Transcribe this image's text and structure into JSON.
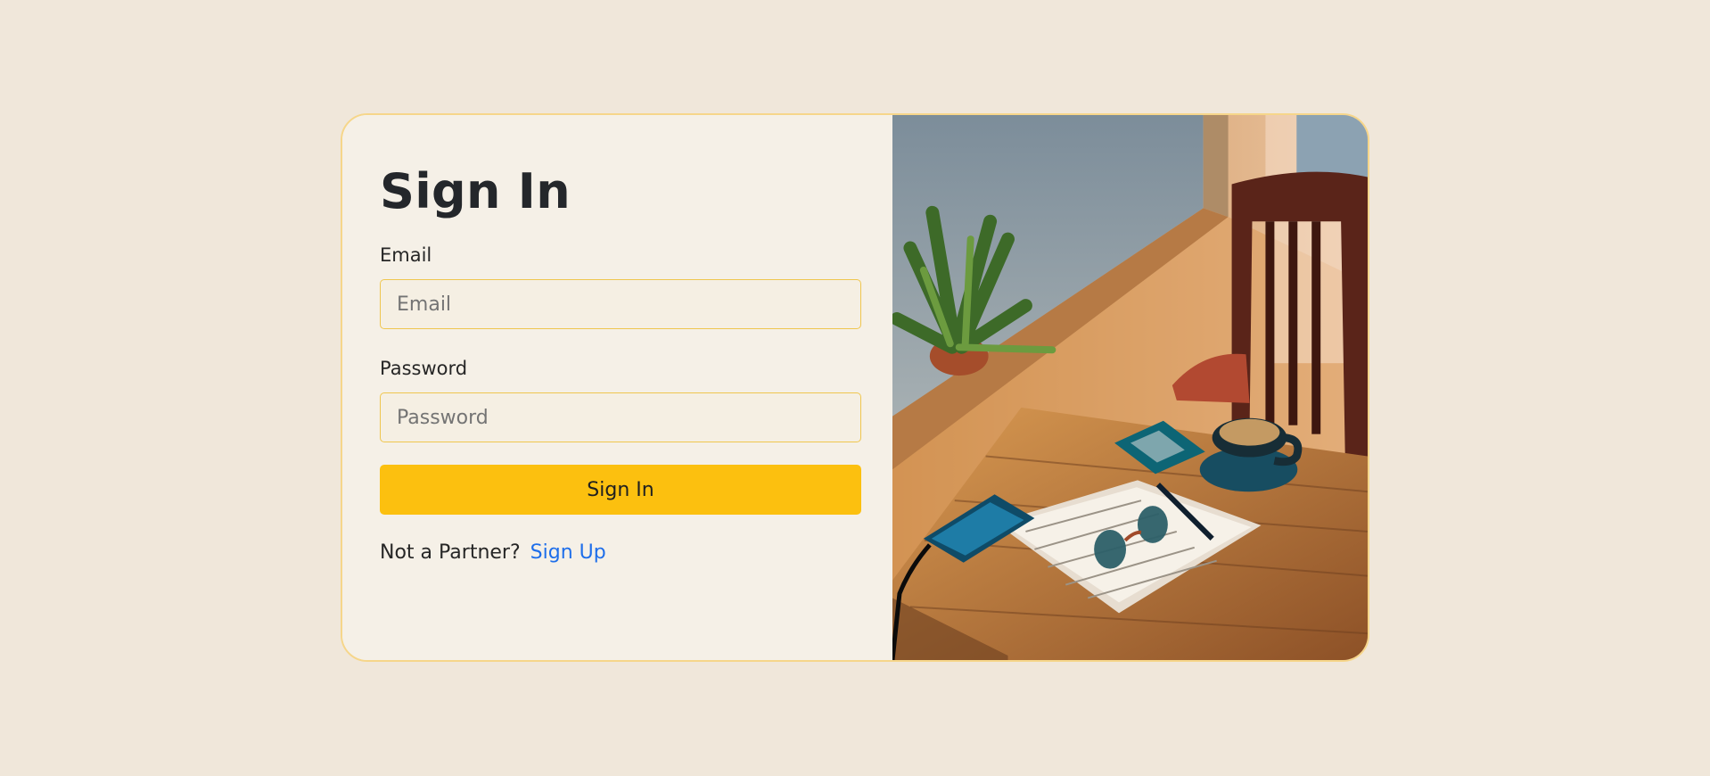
{
  "signin": {
    "title": "Sign In",
    "email_label": "Email",
    "email_placeholder": "Email",
    "email_value": "",
    "password_label": "Password",
    "password_placeholder": "Password",
    "password_value": "",
    "submit_label": "Sign In",
    "signup_prompt": "Not a Partner?",
    "signup_link": "Sign Up"
  },
  "colors": {
    "page_background": "#f0e7da",
    "accent": "#fcc00f",
    "link": "#1e6eea",
    "border": "#f6d68a"
  },
  "image": {
    "icon": "cafe-photo"
  }
}
